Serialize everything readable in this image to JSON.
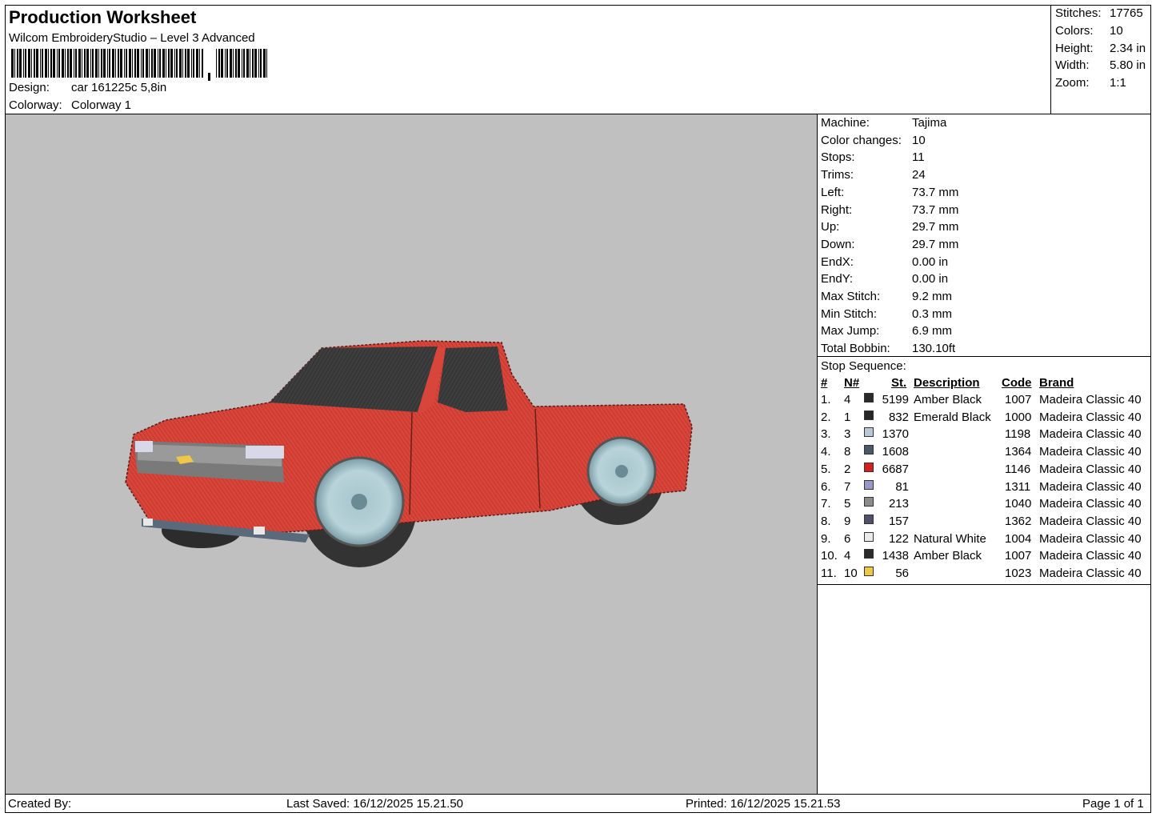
{
  "header": {
    "title": "Production Worksheet",
    "software": "Wilcom EmbroideryStudio – Level 3 Advanced",
    "design_label": "Design:",
    "design_value": "car 161225c 5,8in",
    "colorway_label": "Colorway:",
    "colorway_value": "Colorway 1"
  },
  "stats": [
    {
      "label": "Stitches:",
      "value": "17765"
    },
    {
      "label": "Colors:",
      "value": "10"
    },
    {
      "label": "Height:",
      "value": "2.34 in"
    },
    {
      "label": "Width:",
      "value": "5.80 in"
    },
    {
      "label": "Zoom:",
      "value": "1:1"
    }
  ],
  "machine_info": [
    {
      "label": "Machine:",
      "value": "Tajima"
    },
    {
      "label": "Color changes:",
      "value": "10"
    },
    {
      "label": "Stops:",
      "value": "11"
    },
    {
      "label": "Trims:",
      "value": "24"
    },
    {
      "label": "Left:",
      "value": "73.7 mm"
    },
    {
      "label": "Right:",
      "value": "73.7 mm"
    },
    {
      "label": "Up:",
      "value": "29.7 mm"
    },
    {
      "label": "Down:",
      "value": "29.7 mm"
    },
    {
      "label": "EndX:",
      "value": "0.00 in"
    },
    {
      "label": "EndY:",
      "value": "0.00 in"
    },
    {
      "label": "Max Stitch:",
      "value": "9.2 mm"
    },
    {
      "label": "Min Stitch:",
      "value": "0.3 mm"
    },
    {
      "label": "Max Jump:",
      "value": "6.9 mm"
    },
    {
      "label": "Total Bobbin:",
      "value": "130.10ft"
    }
  ],
  "stop_sequence": {
    "title": "Stop Sequence:",
    "headers": {
      "num": "#",
      "n": "N#",
      "st": "St.",
      "description": "Description",
      "code": "Code",
      "brand": "Brand"
    },
    "rows": [
      {
        "idx": "1.",
        "n": "4",
        "color": "#2a2a2a",
        "st": "5199",
        "description": "Amber Black",
        "code": "1007",
        "brand": "Madeira Classic 40"
      },
      {
        "idx": "2.",
        "n": "1",
        "color": "#262626",
        "st": "832",
        "description": "Emerald Black",
        "code": "1000",
        "brand": "Madeira Classic 40"
      },
      {
        "idx": "3.",
        "n": "3",
        "color": "#b8c8d8",
        "st": "1370",
        "description": "",
        "code": "1198",
        "brand": "Madeira Classic 40"
      },
      {
        "idx": "4.",
        "n": "8",
        "color": "#4a5868",
        "st": "1608",
        "description": "",
        "code": "1364",
        "brand": "Madeira Classic 40"
      },
      {
        "idx": "5.",
        "n": "2",
        "color": "#d42020",
        "st": "6687",
        "description": "",
        "code": "1146",
        "brand": "Madeira Classic 40"
      },
      {
        "idx": "6.",
        "n": "7",
        "color": "#9898c8",
        "st": "81",
        "description": "",
        "code": "1311",
        "brand": "Madeira Classic 40"
      },
      {
        "idx": "7.",
        "n": "5",
        "color": "#8c8c8c",
        "st": "213",
        "description": "",
        "code": "1040",
        "brand": "Madeira Classic 40"
      },
      {
        "idx": "8.",
        "n": "9",
        "color": "#505068",
        "st": "157",
        "description": "",
        "code": "1362",
        "brand": "Madeira Classic 40"
      },
      {
        "idx": "9.",
        "n": "6",
        "color": "#ececec",
        "st": "122",
        "description": "Natural White",
        "code": "1004",
        "brand": "Madeira Classic 40"
      },
      {
        "idx": "10.",
        "n": "4",
        "color": "#2a2a2a",
        "st": "1438",
        "description": "Amber Black",
        "code": "1007",
        "brand": "Madeira Classic 40"
      },
      {
        "idx": "11.",
        "n": "10",
        "color": "#f0c848",
        "st": "56",
        "description": "",
        "code": "1023",
        "brand": "Madeira Classic 40"
      }
    ]
  },
  "footer": {
    "created_by": "Created By:",
    "last_saved": "Last Saved: 16/12/2025 15.21.50",
    "printed": "Printed: 16/12/2025 15.21.53",
    "page": "Page 1 of 1"
  }
}
